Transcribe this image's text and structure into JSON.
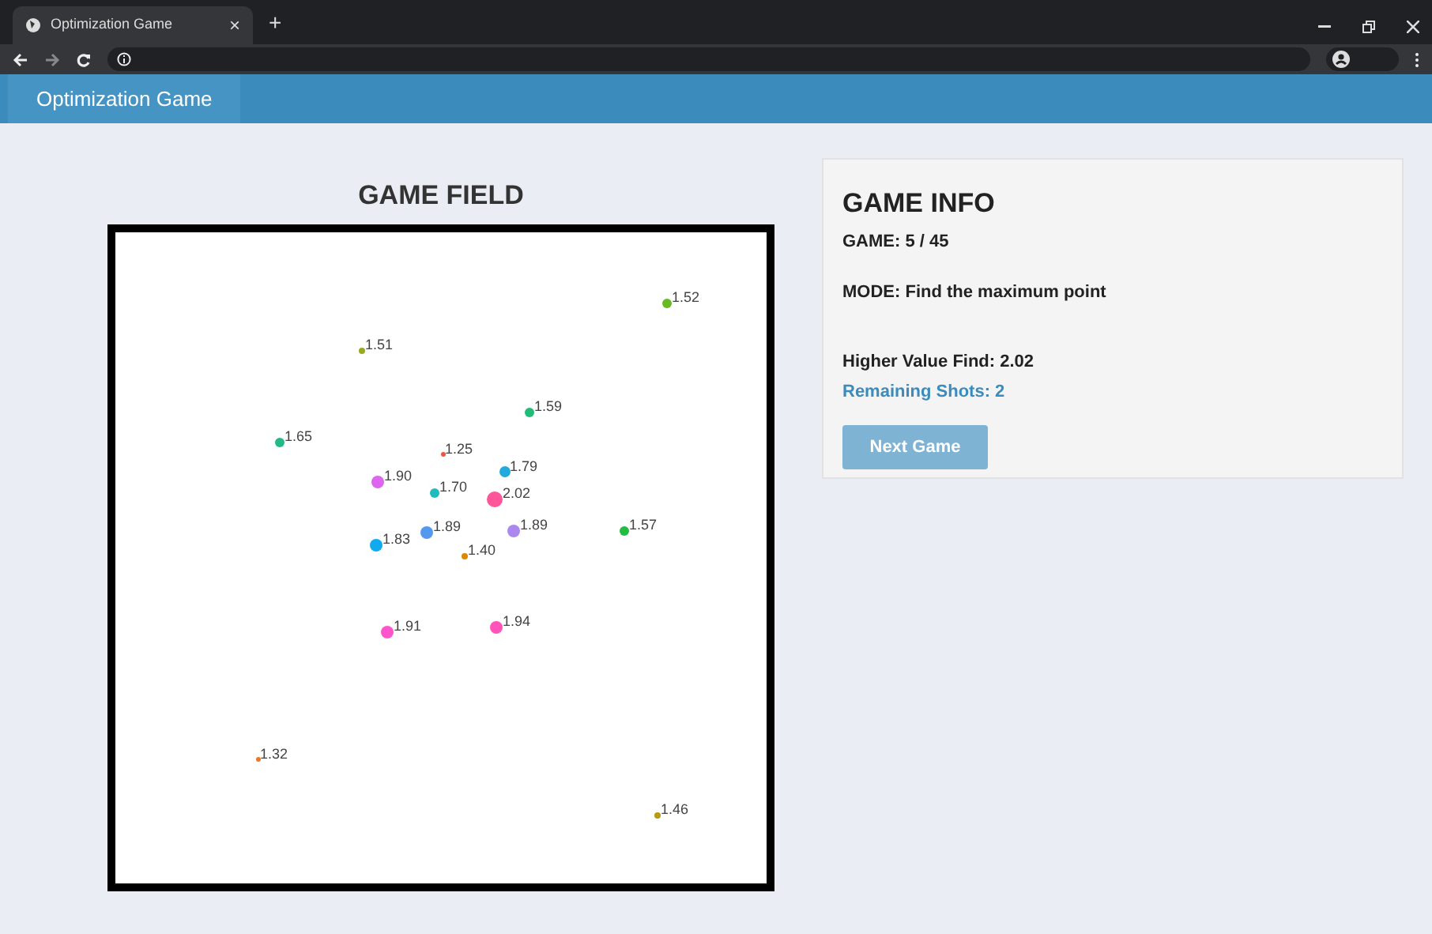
{
  "browser": {
    "tab_title": "Optimization Game",
    "new_tab": "+",
    "close_tab": "×"
  },
  "nav": {
    "brand": "Optimization Game"
  },
  "game_field": {
    "title": "GAME FIELD",
    "points": [
      {
        "label": "1.52",
        "color": "#66bb22"
      },
      {
        "label": "1.51",
        "color": "#99aa22"
      },
      {
        "label": "1.59",
        "color": "#22bb77"
      },
      {
        "label": "1.65",
        "color": "#22bb88"
      },
      {
        "label": "1.25",
        "color": "#ee5544"
      },
      {
        "label": "1.79",
        "color": "#22aadd"
      },
      {
        "label": "1.90",
        "color": "#dd66ee"
      },
      {
        "label": "1.70",
        "color": "#22bbbb"
      },
      {
        "label": "2.02",
        "color": "#ff5599"
      },
      {
        "label": "1.89",
        "color": "#5599ee"
      },
      {
        "label": "1.89",
        "color": "#aa88ee"
      },
      {
        "label": "1.57",
        "color": "#22bb44"
      },
      {
        "label": "1.83",
        "color": "#11aaee"
      },
      {
        "label": "1.40",
        "color": "#dd8800"
      },
      {
        "label": "1.91",
        "color": "#ff55cc"
      },
      {
        "label": "1.94",
        "color": "#ff55bb"
      },
      {
        "label": "1.32",
        "color": "#ee7722"
      },
      {
        "label": "1.46",
        "color": "#bb9911"
      }
    ]
  },
  "game_info": {
    "title": "GAME INFO",
    "game": "GAME: 5 / 45",
    "mode": "MODE: Find the maximum point",
    "higher_value": "Higher Value Find: 2.02",
    "remaining_shots": "Remaining Shots: 2",
    "next_button": {
      "label": "Next Game",
      "disabled": true
    }
  }
}
